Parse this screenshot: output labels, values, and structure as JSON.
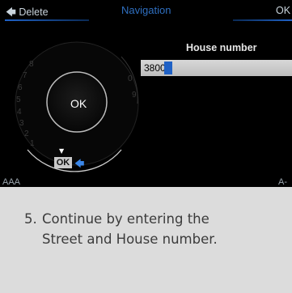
{
  "topbar": {
    "delete_label": "Delete",
    "title": "Navigation",
    "ok_label": "OK"
  },
  "entry": {
    "label": "House number",
    "value": "3800"
  },
  "speller": {
    "center_ok": "OK",
    "select_ok": "OK",
    "digits": [
      "8",
      "7",
      "6",
      "5",
      "4",
      "3",
      "2",
      "1",
      "0",
      "9"
    ]
  },
  "footer": {
    "left": "AAA",
    "right": "A-"
  },
  "caption": {
    "number": "5.",
    "line1": "Continue by entering the",
    "line2": "Street and House number."
  },
  "colors": {
    "accent": "#1f61c5",
    "title": "#2f6fc0",
    "background": "#000000"
  }
}
